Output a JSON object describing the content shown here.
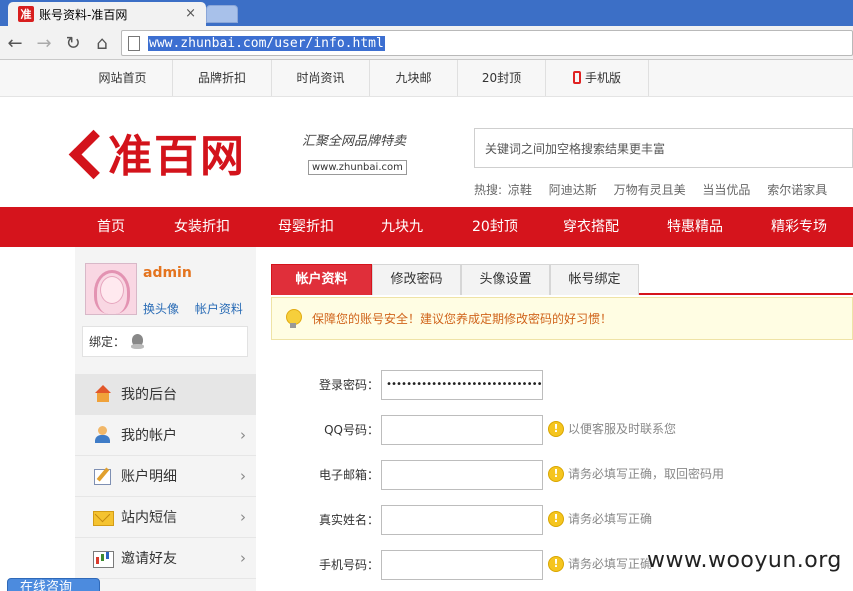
{
  "browser": {
    "tab_title": "账号资料-准百网",
    "tab_close": "×",
    "url": "www.zhunbai.com/user/info.html",
    "favicon_text": "准"
  },
  "top_links": [
    "网站首页",
    "品牌折扣",
    "时尚资讯",
    "九块邮",
    "20封顶",
    "手机版"
  ],
  "header": {
    "logo_text": "准百网",
    "slogan": "汇聚全网品牌特卖",
    "slogan_url": "www.zhunbai.com",
    "search_placeholder": "关键词之间加空格搜索结果更丰富",
    "hot_label": "热搜:",
    "hot_words": [
      "凉鞋",
      "阿迪达斯",
      "万物有灵且美",
      "当当优品",
      "索尔诺家具"
    ]
  },
  "main_nav": [
    "首页",
    "女装折扣",
    "母婴折扣",
    "九块九",
    "20封顶",
    "穿衣搭配",
    "特惠精品",
    "精彩专场"
  ],
  "sidebar": {
    "username": "admin",
    "change_avatar": "换头像",
    "account_info": "帐户资料",
    "bind_label": "绑定：",
    "menu": [
      {
        "label": "我的后台",
        "icon": "home-icon"
      },
      {
        "label": "我的帐户",
        "icon": "user-icon"
      },
      {
        "label": "账户明细",
        "icon": "edit-icon"
      },
      {
        "label": "站内短信",
        "icon": "mail-icon"
      },
      {
        "label": "邀请好友",
        "icon": "chart-icon"
      }
    ],
    "chat_tab": "在线咨询"
  },
  "content": {
    "tabs": [
      "帐户资料",
      "修改密码",
      "头像设置",
      "帐号绑定"
    ],
    "notice": "保障您的账号安全！建议您养成定期修改密码的好习惯！",
    "form": [
      {
        "label": "登录密码：",
        "value": "••••••••••••••••••••••••••••••••",
        "hint": ""
      },
      {
        "label": "QQ号码：",
        "value": "",
        "hint": "以便客服及时联系您"
      },
      {
        "label": "电子邮箱：",
        "value": "",
        "hint": "请务必填写正确，取回密码用"
      },
      {
        "label": "真实姓名：",
        "value": "",
        "hint": "请务必填写正确"
      },
      {
        "label": "手机号码：",
        "value": "",
        "hint": "请务必填写正确"
      }
    ]
  },
  "watermark": "www.wooyun.org",
  "colors": {
    "brand_red": "#d5141c",
    "chrome_blue": "#3c6fc6",
    "notice_text": "#d0641b"
  }
}
